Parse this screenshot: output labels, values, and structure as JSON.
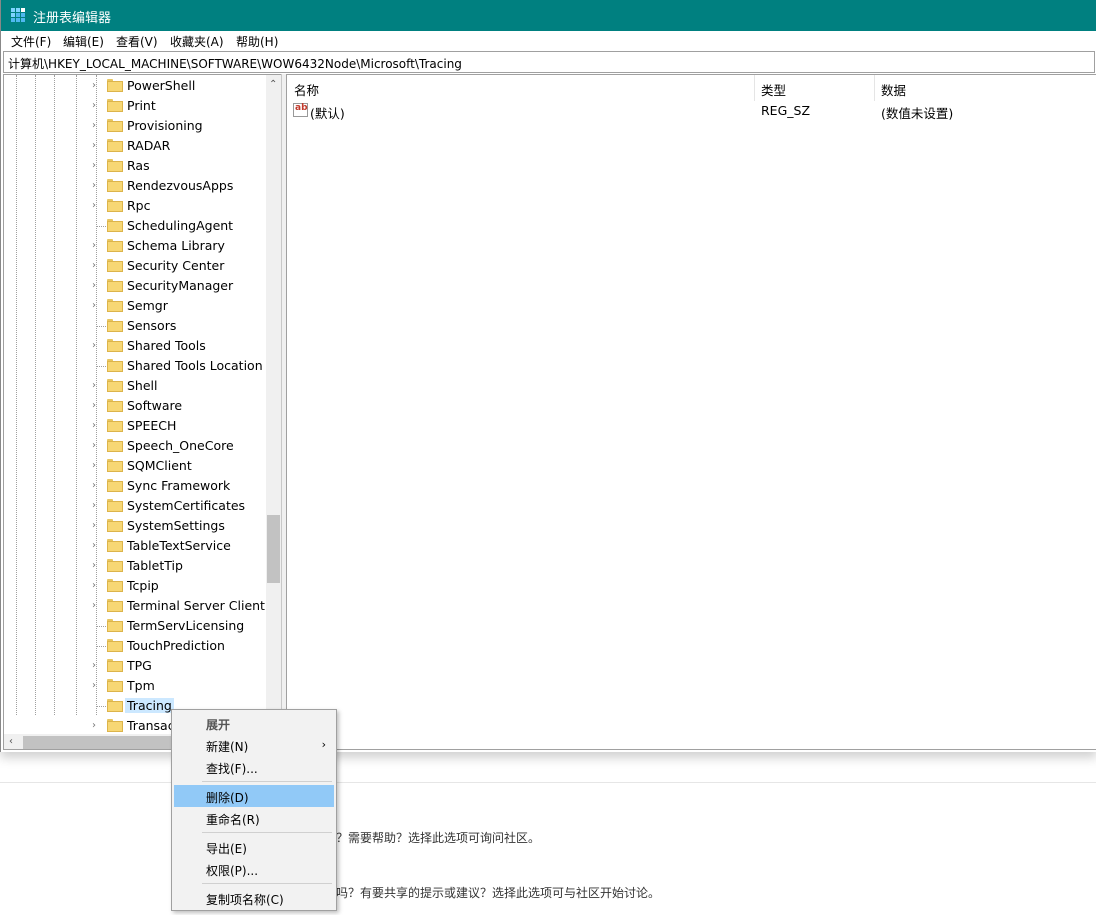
{
  "window": {
    "title": "注册表编辑器"
  },
  "menu": [
    "文件(F)",
    "编辑(E)",
    "查看(V)",
    "收藏夹(A)",
    "帮助(H)"
  ],
  "address": "计算机\\HKEY_LOCAL_MACHINE\\SOFTWARE\\WOW6432Node\\Microsoft\\Tracing",
  "tree": {
    "items": [
      {
        "label": "PowerShell",
        "expandable": true
      },
      {
        "label": "Print",
        "expandable": true
      },
      {
        "label": "Provisioning",
        "expandable": true
      },
      {
        "label": "RADAR",
        "expandable": true
      },
      {
        "label": "Ras",
        "expandable": true
      },
      {
        "label": "RendezvousApps",
        "expandable": true
      },
      {
        "label": "Rpc",
        "expandable": true
      },
      {
        "label": "SchedulingAgent",
        "expandable": false
      },
      {
        "label": "Schema Library",
        "expandable": true
      },
      {
        "label": "Security Center",
        "expandable": true
      },
      {
        "label": "SecurityManager",
        "expandable": true
      },
      {
        "label": "Semgr",
        "expandable": true
      },
      {
        "label": "Sensors",
        "expandable": false
      },
      {
        "label": "Shared Tools",
        "expandable": true
      },
      {
        "label": "Shared Tools Location",
        "expandable": false
      },
      {
        "label": "Shell",
        "expandable": true
      },
      {
        "label": "Software",
        "expandable": true
      },
      {
        "label": "SPEECH",
        "expandable": true
      },
      {
        "label": "Speech_OneCore",
        "expandable": true
      },
      {
        "label": "SQMClient",
        "expandable": true
      },
      {
        "label": "Sync Framework",
        "expandable": true
      },
      {
        "label": "SystemCertificates",
        "expandable": true
      },
      {
        "label": "SystemSettings",
        "expandable": true
      },
      {
        "label": "TableTextService",
        "expandable": true
      },
      {
        "label": "TabletTip",
        "expandable": true
      },
      {
        "label": "Tcpip",
        "expandable": true
      },
      {
        "label": "Terminal Server Client",
        "expandable": true
      },
      {
        "label": "TermServLicensing",
        "expandable": false
      },
      {
        "label": "TouchPrediction",
        "expandable": false
      },
      {
        "label": "TPG",
        "expandable": true
      },
      {
        "label": "Tpm",
        "expandable": true
      },
      {
        "label": "Tracing",
        "expandable": false,
        "selected": true
      },
      {
        "label": "Transac",
        "expandable": true
      }
    ]
  },
  "list": {
    "columns": [
      "名称",
      "类型",
      "数据"
    ],
    "rows": [
      {
        "name": "(默认)",
        "type": "REG_SZ",
        "data": "(数值未设置)",
        "icon": "ab-string-icon"
      }
    ]
  },
  "context_menu": {
    "items": [
      {
        "label": "展开",
        "bold": true
      },
      {
        "label": "新建(N)",
        "submenu": true
      },
      {
        "label": "查找(F)..."
      },
      {
        "label": "删除(D)",
        "highlighted": true
      },
      {
        "label": "重命名(R)"
      },
      {
        "label": "导出(E)"
      },
      {
        "label": "权限(P)..."
      },
      {
        "label": "复制项名称(C)"
      }
    ]
  },
  "background": {
    "line1": "帮助？需要帮助？选择此选项可询问社区。",
    "line2": "意见吗？有要共享的提示或建议？选择此选项可与社区开始讨论。"
  },
  "colors": {
    "titlebar": "#008080",
    "selection": "#cce8ff",
    "menu_highlight": "#91c9f7"
  }
}
